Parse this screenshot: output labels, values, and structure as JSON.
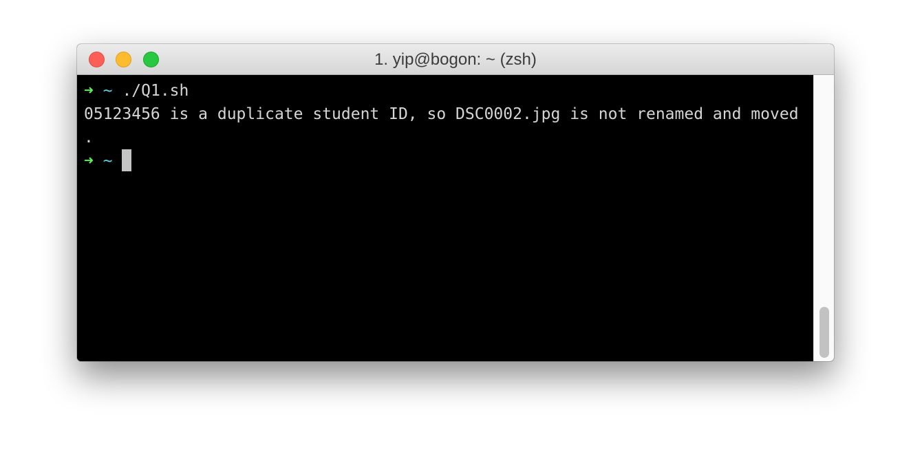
{
  "window": {
    "title": "1. yip@bogon: ~ (zsh)"
  },
  "terminal": {
    "lines": [
      {
        "prompt_symbol": "➜",
        "cwd": "~",
        "command": "./Q1.sh"
      },
      {
        "output": "05123456 is a duplicate student ID, so DSC0002.jpg is not renamed and moved"
      },
      {
        "output": "."
      },
      {
        "prompt_symbol": "➜",
        "cwd": "~",
        "command": ""
      }
    ]
  },
  "colors": {
    "prompt_arrow": "#5ff05f",
    "cwd": "#58d6e4",
    "text": "#d5d5d5",
    "background": "#000000"
  },
  "icons": {
    "close": "close-icon",
    "minimize": "minimize-icon",
    "maximize": "maximize-icon"
  }
}
